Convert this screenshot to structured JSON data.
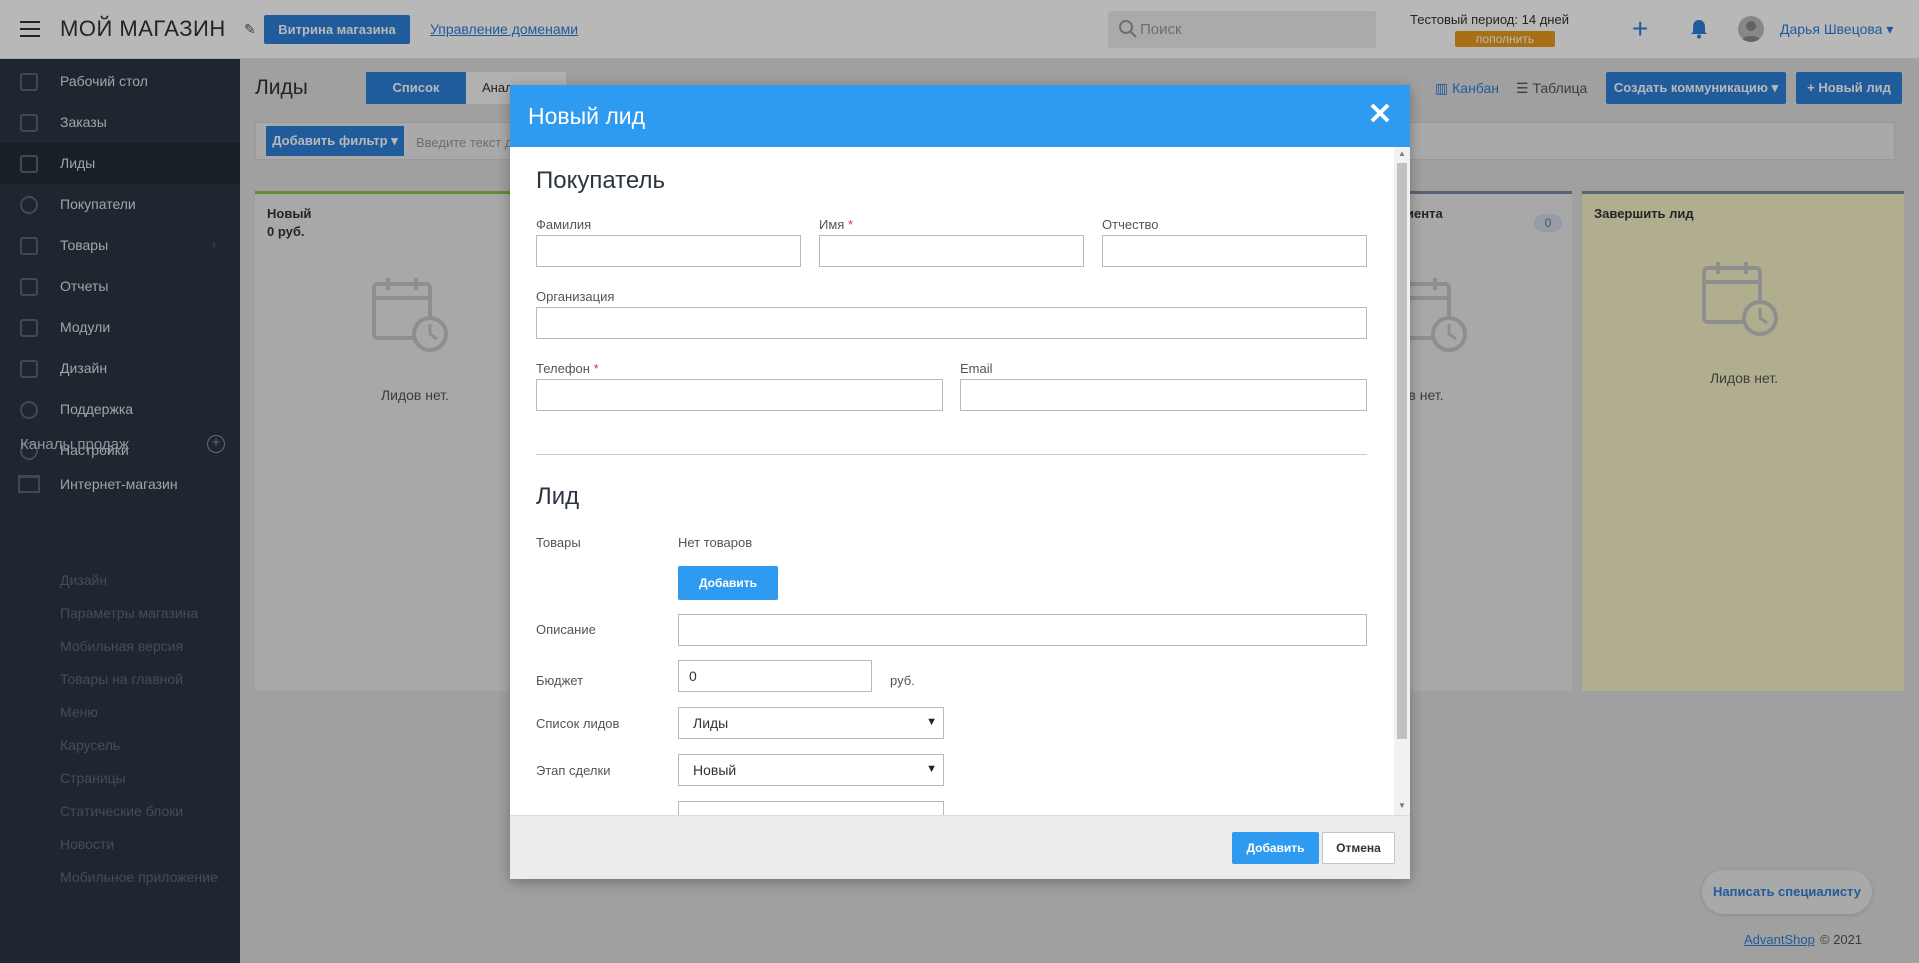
{
  "header": {
    "shop_title": "МОЙ МАГАЗИН",
    "storefront_btn": "Витрина магазина",
    "domains_link": "Управление доменами",
    "search_placeholder": "Поиск",
    "trial_label": "Тестовый период:",
    "trial_days": "14 дней",
    "topup_btn": "пополнить",
    "user_name": "Дарья Швецова ▾"
  },
  "sidebar": {
    "items": [
      {
        "label": "Рабочий стол"
      },
      {
        "label": "Заказы"
      },
      {
        "label": "Лиды"
      },
      {
        "label": "Покупатели"
      },
      {
        "label": "Товары"
      },
      {
        "label": "Отчеты"
      },
      {
        "label": "Модули"
      },
      {
        "label": "Дизайн"
      },
      {
        "label": "Поддержка"
      },
      {
        "label": "Настройки"
      }
    ],
    "channels_title": "Каналы продаж",
    "eshop_label": "Интернет-магазин",
    "sub_items": [
      "Дизайн",
      "Параметры магазина",
      "Мобильная версия",
      "Товары на главной",
      "Меню",
      "Карусель",
      "Страницы",
      "Статические блоки",
      "Новости",
      "Мобильное приложение"
    ]
  },
  "page": {
    "title": "Лиды",
    "tab_list": "Список",
    "tab_analytics": "Анал",
    "view_kanban": "Канбан",
    "view_table": "Таблица",
    "create_comm_btn": "Создать коммуникацию ▾",
    "new_lead_btn": "Новый лид",
    "add_filter_btn": "Добавить фильтр ▾",
    "filter_placeholder": "Введите текст д",
    "kanban": {
      "col_new_title": "Новый",
      "col_new_sum": "0  руб.",
      "col_client_title": "иента",
      "col_client_count": "0",
      "col_finish_title": "Завершить лид",
      "empty_text": "Лидов нет.",
      "empty_text_partial": "в нет."
    }
  },
  "footer": {
    "link": "AdvantShop",
    "copy": "© 2021",
    "chat_btn": "Написать специалисту"
  },
  "modal": {
    "title": "Новый лид",
    "buyer_section": "Покупатель",
    "last_name_label": "Фамилия",
    "first_name_label": "Имя",
    "middle_name_label": "Отчество",
    "org_label": "Организация",
    "phone_label": "Телефон",
    "email_label": "Email",
    "required_mark": "*",
    "lead_section": "Лид",
    "goods_label": "Товары",
    "no_goods": "Нет товаров",
    "add_goods_btn": "Добавить",
    "description_label": "Описание",
    "budget_label": "Бюджет",
    "budget_value": "0",
    "budget_unit": "руб.",
    "list_label": "Список лидов",
    "list_value": "Лиды",
    "stage_label": "Этап сделки",
    "stage_value": "Новый",
    "submit_btn": "Добавить",
    "cancel_btn": "Отмена"
  },
  "colors": {
    "accent": "#2e9af0",
    "sidebar": "#2b3542",
    "topup": "#e89c1c"
  }
}
